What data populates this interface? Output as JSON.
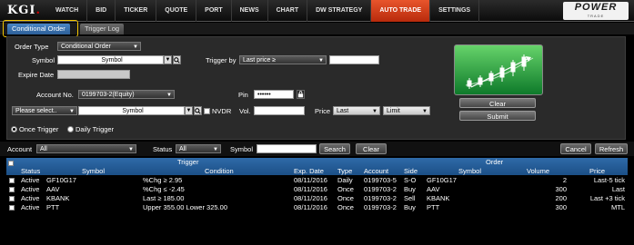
{
  "app": {
    "logo": "KGI",
    "brand_line1": "POWER",
    "brand_line2": "TRADE"
  },
  "nav": [
    "WATCH",
    "BID",
    "TICKER",
    "QUOTE",
    "PORT",
    "NEWS",
    "CHART",
    "DW STRATEGY",
    "AUTO TRADE",
    "SETTINGS"
  ],
  "nav_active": "AUTO TRADE",
  "subtabs": {
    "conditional": "Conditional Order",
    "trigger_log": "Trigger Log"
  },
  "form": {
    "order_type_label": "Order Type",
    "order_type_value": "Conditional Order",
    "symbol_label": "Symbol",
    "symbol_placeholder": "Symbol",
    "trigger_by_label": "Trigger by",
    "trigger_by_value": "Last price ≥",
    "expire_label": "Expire Date",
    "account_label": "Account No.",
    "account_value": "0199703-2(Equity)",
    "pin_label": "Pin",
    "pin_value": "••••••",
    "please_select": "Please select..",
    "symbol2_placeholder": "Symbol",
    "nvdr_label": "NVDR",
    "vol_label": "Vol.",
    "price_label": "Price",
    "price_type": "Last",
    "order_kind": "Limit",
    "once_trigger": "Once Trigger",
    "daily_trigger": "Daily Trigger",
    "clear_button": "Clear",
    "submit_button": "Submit"
  },
  "filter": {
    "account_label": "Account",
    "account_value": "All",
    "status_label": "Status",
    "status_value": "All",
    "symbol_label": "Symbol",
    "search_button": "Search",
    "clear_button": "Clear",
    "cancel_button": "Cancel",
    "refresh_button": "Refresh"
  },
  "table": {
    "group_trigger": "Trigger",
    "group_order": "Order",
    "headers": {
      "status": "Status",
      "symbol": "Symbol",
      "condition": "Condition",
      "exp_date": "Exp. Date",
      "type": "Type",
      "account": "Account",
      "side": "Side",
      "order_symbol": "Symbol",
      "volume": "Volume",
      "price": "Price"
    },
    "rows": [
      {
        "status": "Active",
        "symbol": "GF10G17",
        "condition": "%Chg ≥ 2.95",
        "exp_date": "08/11/2016",
        "type": "Daily",
        "account": "0199703-5",
        "side": "S-O",
        "order_symbol": "GF10G17",
        "volume": "2",
        "price": "Last-5 tick"
      },
      {
        "status": "Active",
        "symbol": "AAV",
        "condition": "%Chg ≤ -2.45",
        "exp_date": "08/11/2016",
        "type": "Once",
        "account": "0199703-2",
        "side": "Buy",
        "order_symbol": "AAV",
        "volume": "300",
        "price": "Last"
      },
      {
        "status": "Active",
        "symbol": "KBANK",
        "condition": "Last ≥ 185.00",
        "exp_date": "08/11/2016",
        "type": "Once",
        "account": "0199703-2",
        "side": "Sell",
        "order_symbol": "KBANK",
        "volume": "200",
        "price": "Last +3 tick"
      },
      {
        "status": "Active",
        "symbol": "PTT",
        "condition": "Upper 355.00 Lower 325.00",
        "exp_date": "08/11/2016",
        "type": "Once",
        "account": "0199703-2",
        "side": "Buy",
        "order_symbol": "PTT",
        "volume": "300",
        "price": "MTL"
      }
    ]
  },
  "colors": {
    "active_tab": "#d9401a",
    "header_blue": "#2a62a0",
    "chart_green": "#2fa84a",
    "highlight": "#f2c500"
  }
}
